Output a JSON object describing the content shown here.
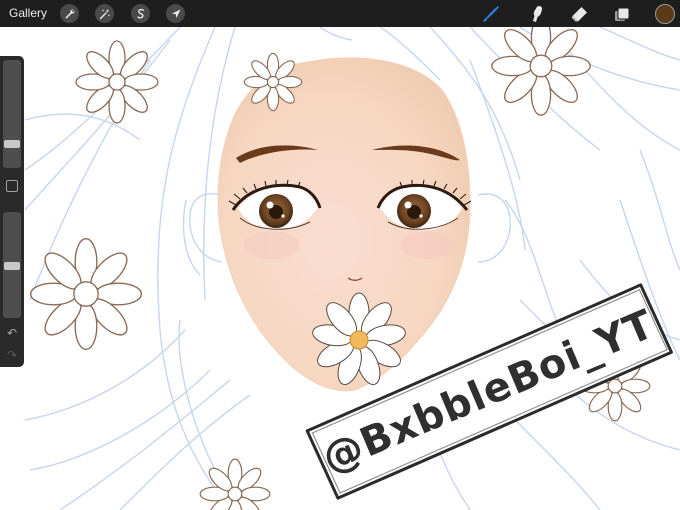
{
  "app": {
    "gallery_label": "Gallery"
  },
  "toolbar": {
    "left_tools": [
      "actions-wrench-icon",
      "adjustments-wand-icon",
      "selection-s-icon",
      "transform-arrow-icon"
    ],
    "right_tools": [
      "brush-icon",
      "smudge-icon",
      "eraser-icon",
      "layers-icon"
    ],
    "active_tool": "brush-icon",
    "brush_color": "#2d7dd8",
    "current_color": "#5b3a17"
  },
  "sidebar": {
    "brush_size_level": 0.74,
    "opacity_level": 0.55,
    "undo_icon": "↶",
    "redo_icon": "↷"
  },
  "canvas": {
    "watermark_text": "@BxbbleBoi_YT",
    "skin_color": "#f6d8c2",
    "sketch_line_color": "#c5d6ee",
    "brow_color": "#6b3a1a",
    "iris_color": "#6b4323"
  }
}
